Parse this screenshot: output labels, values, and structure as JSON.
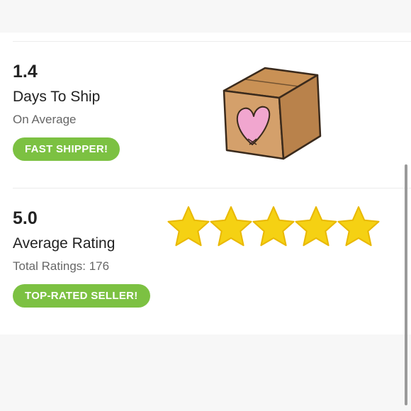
{
  "shipping": {
    "value": "1.4",
    "label": "Days To Ship",
    "sublabel": "On Average",
    "badge": "FAST SHIPPER!",
    "illustration_icon": "shipping-box-heart-icon"
  },
  "rating": {
    "value": "5.0",
    "label": "Average Rating",
    "sublabel": "Total Ratings: 176",
    "badge": "TOP-RATED SELLER!",
    "stars": 5,
    "stars_max": 5,
    "star_icon": "star-icon"
  },
  "colors": {
    "badge_green": "#7cc142",
    "star_yellow": "#f5d113",
    "box_brown": "#d4a06b",
    "heart_pink": "#f1a6cf"
  }
}
